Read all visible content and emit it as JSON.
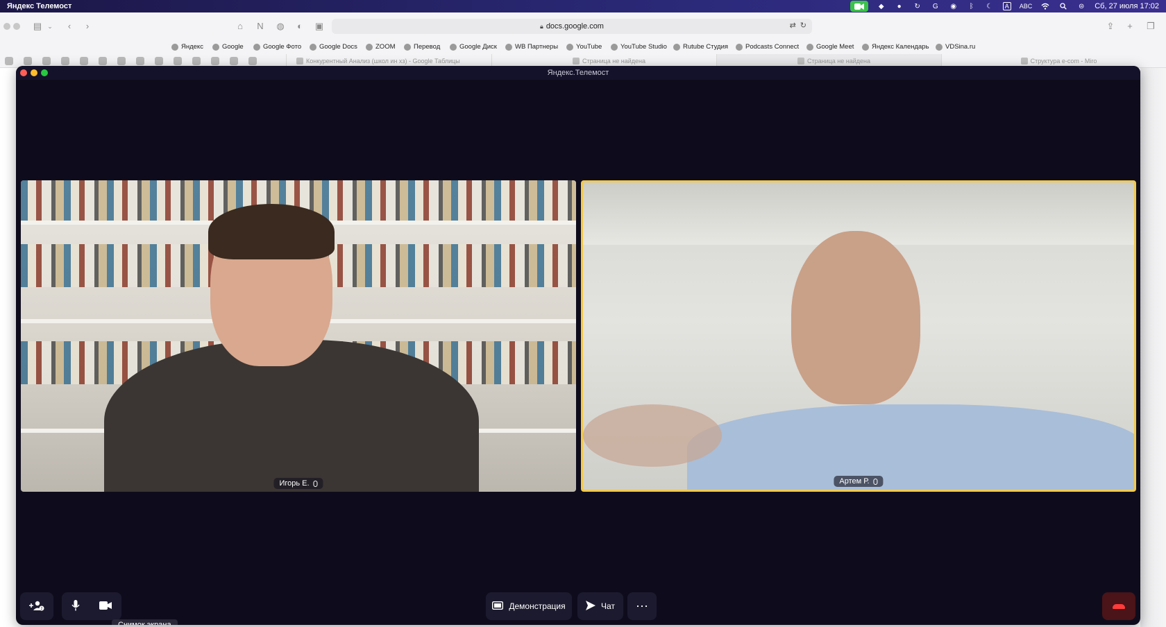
{
  "menubar": {
    "app_name": "Яндекс Телемост",
    "input_source": "ABC",
    "datetime": "Сб, 27 июля 17:02",
    "icons": [
      "facetime-icon",
      "dropbox-icon",
      "zoom-icon",
      "sync-icon",
      "grammarly-icon",
      "onepassword-icon",
      "bluetooth-icon",
      "moon-icon",
      "input-icon",
      "wifi-icon",
      "search-icon",
      "control-center-icon"
    ]
  },
  "browser": {
    "url": "docs.google.com",
    "bookmarks": [
      "Яндекс",
      "Google",
      "Google Фото",
      "Google Docs",
      "ZOOM",
      "Перевод",
      "Google Диск",
      "WB Партнеры",
      "YouTube",
      "YouTube Studio",
      "Rutube Студия",
      "Podcasts Connect",
      "Google Meet",
      "Яндекс Календарь",
      "VDSina.ru"
    ],
    "tabs": [
      "Конкурентный Анализ (школ ин хз) - Google Таблицы",
      "Страница не найдена",
      "Страница не найдена",
      "Структура e-com - Miro"
    ]
  },
  "window": {
    "title": "Яндекс.Телемост"
  },
  "participants": [
    {
      "name": "Игорь Е.",
      "active_speaker": false
    },
    {
      "name": "Артем Р.",
      "active_speaker": true
    }
  ],
  "controls": {
    "demo_label": "Демонстрация",
    "chat_label": "Чат",
    "more_label": "⋯",
    "tooltip": "Снимок экрана"
  },
  "colors": {
    "active_speaker_border": "#f2c94c",
    "end_call": "#ff3b3b",
    "window_bg": "#0e0c1c"
  }
}
